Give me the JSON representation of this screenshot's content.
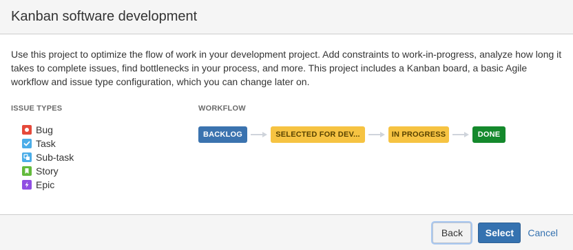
{
  "dialog": {
    "title": "Kanban software development",
    "description": "Use this project to optimize the flow of work in your development project. Add constraints to work-in-progress, analyze how long it takes to complete issues, find bottlenecks in your process, and more. This project includes a Kanban board, a basic Agile workflow and issue type configuration, which you can change later on."
  },
  "issue_types": {
    "heading": "ISSUE TYPES",
    "items": [
      {
        "label": "Bug",
        "icon": "bug-icon",
        "color": "#e5493a"
      },
      {
        "label": "Task",
        "icon": "task-icon",
        "color": "#4bade8"
      },
      {
        "label": "Sub-task",
        "icon": "subtask-icon",
        "color": "#4bade8"
      },
      {
        "label": "Story",
        "icon": "story-icon",
        "color": "#63ba3c"
      },
      {
        "label": "Epic",
        "icon": "epic-icon",
        "color": "#904ee2"
      }
    ]
  },
  "workflow": {
    "heading": "WORKFLOW",
    "statuses": [
      {
        "label": "BACKLOG",
        "color": "#3b73af"
      },
      {
        "label": "SELECTED FOR DEV...",
        "color": "#f6c342"
      },
      {
        "label": "IN PROGRESS",
        "color": "#f6c342"
      },
      {
        "label": "DONE",
        "color": "#14892c"
      }
    ]
  },
  "footer": {
    "back_label": "Back",
    "select_label": "Select",
    "cancel_label": "Cancel"
  }
}
